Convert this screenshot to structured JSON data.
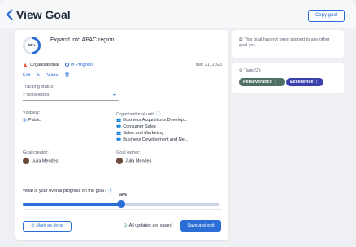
{
  "header": {
    "title": "View Goal",
    "copy_label": "Copy goal"
  },
  "goal": {
    "percent_label": "50%",
    "name": "Expand into APAC region",
    "type": "Organisational",
    "status": "In Progress",
    "date": "Mar 31, 2023",
    "edit_label": "Edit",
    "delete_label": "Delete"
  },
  "tracking": {
    "label": "Tracking status:",
    "value": "Not selected",
    "prefix": "×"
  },
  "visibility": {
    "label": "Visibility:",
    "value": "Public"
  },
  "org_unit": {
    "label": "Organisational unit:",
    "units": [
      "Business Acquisitions Develop...",
      "Consumer Sales",
      "Sales and Marketing",
      "Business Development and Ne..."
    ]
  },
  "creator": {
    "label": "Goal creator:",
    "name": "Julia Mendes"
  },
  "owner": {
    "label": "Goal owner:",
    "name": "Julia Mendes"
  },
  "progress": {
    "question": "What is your overall progress on the goal?",
    "value_label": "50%",
    "value": 0.5
  },
  "footer": {
    "mark_done": "Mark as done",
    "saved": "All updates are saved",
    "save_exit": "Save and exit"
  },
  "alignment": {
    "text": "This goal has not been aligned to any other goal yet."
  },
  "tags": {
    "label": "Tags (2):",
    "items": [
      "Perseverance",
      "Excellence"
    ]
  },
  "colors": {
    "accent": "#2b6fd6",
    "tag1": "#4e6f66",
    "tag2": "#3a3fae",
    "org": "#e45d3a"
  }
}
